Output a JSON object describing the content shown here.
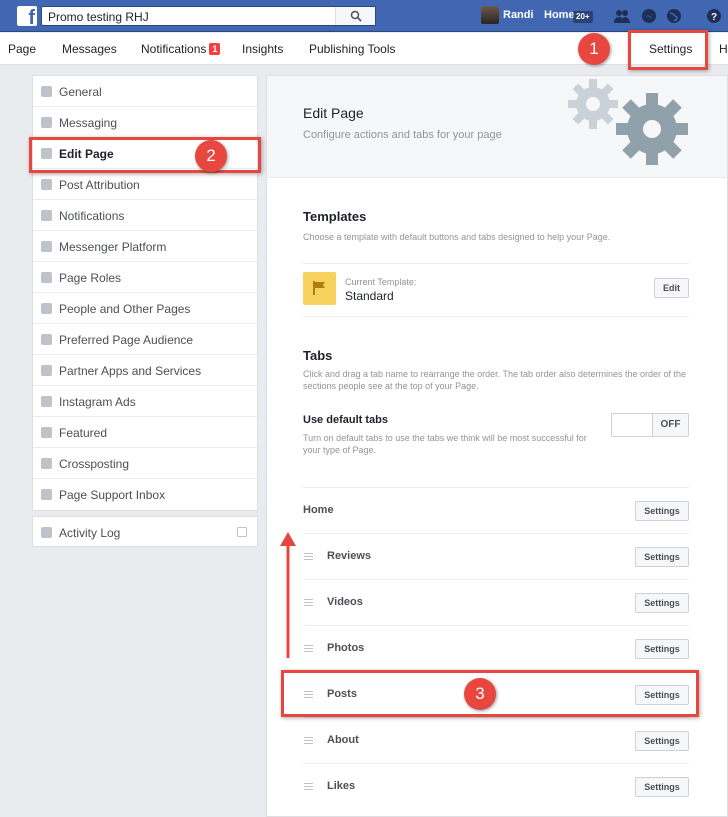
{
  "topbar": {
    "search_value": "Promo testing RHJ",
    "user_name": "Randi",
    "home_label": "Home",
    "home_badge": "20+"
  },
  "pagenav": {
    "items": [
      "Page",
      "Messages",
      "Notifications",
      "Insights",
      "Publishing Tools"
    ],
    "notifications_badge": "1",
    "settings_label": "Settings",
    "cut_label": "H"
  },
  "callouts": [
    "1",
    "2",
    "3"
  ],
  "sidebar": {
    "items": [
      {
        "label": "General",
        "icon": "gear-icon"
      },
      {
        "label": "Messaging",
        "icon": "messaging-icon"
      },
      {
        "label": "Edit Page",
        "icon": "gear-icon"
      },
      {
        "label": "Post Attribution",
        "icon": "flag-icon"
      },
      {
        "label": "Notifications",
        "icon": "globe-icon"
      },
      {
        "label": "Messenger Platform",
        "icon": "messenger-icon"
      },
      {
        "label": "Page Roles",
        "icon": "person-icon"
      },
      {
        "label": "People and Other Pages",
        "icon": "people-icon"
      },
      {
        "label": "Preferred Page Audience",
        "icon": "people-icon"
      },
      {
        "label": "Partner Apps and Services",
        "icon": "cube-icon"
      },
      {
        "label": "Instagram Ads",
        "icon": "instagram-icon"
      },
      {
        "label": "Featured",
        "icon": "star-icon"
      },
      {
        "label": "Crossposting",
        "icon": "video-icon"
      },
      {
        "label": "Page Support Inbox",
        "icon": "facebook-icon"
      }
    ],
    "activity_log": "Activity Log"
  },
  "main": {
    "title": "Edit Page",
    "subtitle": "Configure actions and tabs for your page",
    "templates": {
      "title": "Templates",
      "desc": "Choose a template with default buttons and tabs designed to help your Page.",
      "current_label": "Current Template:",
      "current_value": "Standard",
      "edit_label": "Edit"
    },
    "tabs": {
      "title": "Tabs",
      "desc": "Click and drag a tab name to rearrange the order. The tab order also determines the order of the sections people see at the top of your Page.",
      "default_title": "Use default tabs",
      "default_desc": "Turn on default tabs to use the tabs we think will be most successful for your type of Page.",
      "toggle_label": "OFF",
      "list": [
        "Home",
        "Reviews",
        "Videos",
        "Photos",
        "Posts",
        "About",
        "Likes"
      ],
      "settings_label": "Settings"
    }
  },
  "colors": {
    "facebook_blue": "#4267b2",
    "callout_red": "#e8473f",
    "gear_gray": "#91a1ab",
    "template_yellow": "#f7d25d"
  }
}
